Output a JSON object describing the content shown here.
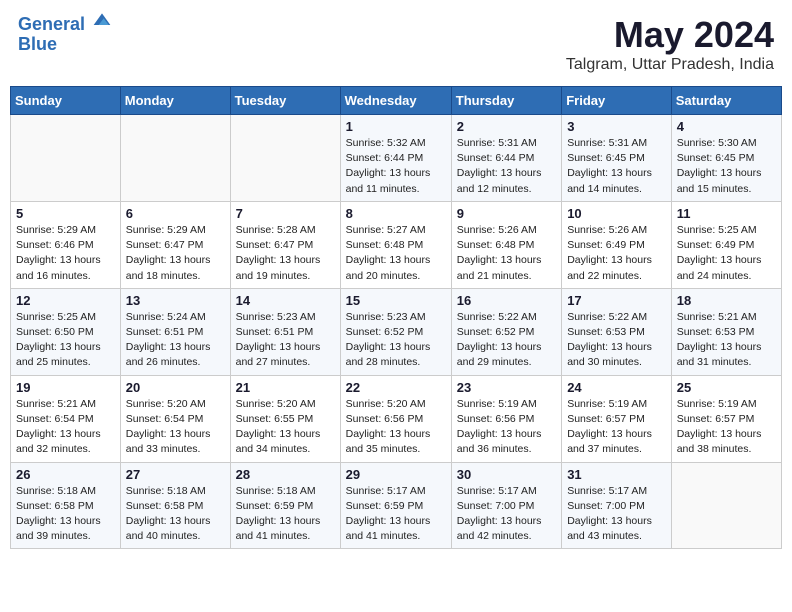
{
  "header": {
    "logo_line1": "General",
    "logo_line2": "Blue",
    "month_year": "May 2024",
    "location": "Talgram, Uttar Pradesh, India"
  },
  "calendar": {
    "days_of_week": [
      "Sunday",
      "Monday",
      "Tuesday",
      "Wednesday",
      "Thursday",
      "Friday",
      "Saturday"
    ],
    "weeks": [
      [
        {
          "day": "",
          "info": ""
        },
        {
          "day": "",
          "info": ""
        },
        {
          "day": "",
          "info": ""
        },
        {
          "day": "1",
          "info": "Sunrise: 5:32 AM\nSunset: 6:44 PM\nDaylight: 13 hours\nand 11 minutes."
        },
        {
          "day": "2",
          "info": "Sunrise: 5:31 AM\nSunset: 6:44 PM\nDaylight: 13 hours\nand 12 minutes."
        },
        {
          "day": "3",
          "info": "Sunrise: 5:31 AM\nSunset: 6:45 PM\nDaylight: 13 hours\nand 14 minutes."
        },
        {
          "day": "4",
          "info": "Sunrise: 5:30 AM\nSunset: 6:45 PM\nDaylight: 13 hours\nand 15 minutes."
        }
      ],
      [
        {
          "day": "5",
          "info": "Sunrise: 5:29 AM\nSunset: 6:46 PM\nDaylight: 13 hours\nand 16 minutes."
        },
        {
          "day": "6",
          "info": "Sunrise: 5:29 AM\nSunset: 6:47 PM\nDaylight: 13 hours\nand 18 minutes."
        },
        {
          "day": "7",
          "info": "Sunrise: 5:28 AM\nSunset: 6:47 PM\nDaylight: 13 hours\nand 19 minutes."
        },
        {
          "day": "8",
          "info": "Sunrise: 5:27 AM\nSunset: 6:48 PM\nDaylight: 13 hours\nand 20 minutes."
        },
        {
          "day": "9",
          "info": "Sunrise: 5:26 AM\nSunset: 6:48 PM\nDaylight: 13 hours\nand 21 minutes."
        },
        {
          "day": "10",
          "info": "Sunrise: 5:26 AM\nSunset: 6:49 PM\nDaylight: 13 hours\nand 22 minutes."
        },
        {
          "day": "11",
          "info": "Sunrise: 5:25 AM\nSunset: 6:49 PM\nDaylight: 13 hours\nand 24 minutes."
        }
      ],
      [
        {
          "day": "12",
          "info": "Sunrise: 5:25 AM\nSunset: 6:50 PM\nDaylight: 13 hours\nand 25 minutes."
        },
        {
          "day": "13",
          "info": "Sunrise: 5:24 AM\nSunset: 6:51 PM\nDaylight: 13 hours\nand 26 minutes."
        },
        {
          "day": "14",
          "info": "Sunrise: 5:23 AM\nSunset: 6:51 PM\nDaylight: 13 hours\nand 27 minutes."
        },
        {
          "day": "15",
          "info": "Sunrise: 5:23 AM\nSunset: 6:52 PM\nDaylight: 13 hours\nand 28 minutes."
        },
        {
          "day": "16",
          "info": "Sunrise: 5:22 AM\nSunset: 6:52 PM\nDaylight: 13 hours\nand 29 minutes."
        },
        {
          "day": "17",
          "info": "Sunrise: 5:22 AM\nSunset: 6:53 PM\nDaylight: 13 hours\nand 30 minutes."
        },
        {
          "day": "18",
          "info": "Sunrise: 5:21 AM\nSunset: 6:53 PM\nDaylight: 13 hours\nand 31 minutes."
        }
      ],
      [
        {
          "day": "19",
          "info": "Sunrise: 5:21 AM\nSunset: 6:54 PM\nDaylight: 13 hours\nand 32 minutes."
        },
        {
          "day": "20",
          "info": "Sunrise: 5:20 AM\nSunset: 6:54 PM\nDaylight: 13 hours\nand 33 minutes."
        },
        {
          "day": "21",
          "info": "Sunrise: 5:20 AM\nSunset: 6:55 PM\nDaylight: 13 hours\nand 34 minutes."
        },
        {
          "day": "22",
          "info": "Sunrise: 5:20 AM\nSunset: 6:56 PM\nDaylight: 13 hours\nand 35 minutes."
        },
        {
          "day": "23",
          "info": "Sunrise: 5:19 AM\nSunset: 6:56 PM\nDaylight: 13 hours\nand 36 minutes."
        },
        {
          "day": "24",
          "info": "Sunrise: 5:19 AM\nSunset: 6:57 PM\nDaylight: 13 hours\nand 37 minutes."
        },
        {
          "day": "25",
          "info": "Sunrise: 5:19 AM\nSunset: 6:57 PM\nDaylight: 13 hours\nand 38 minutes."
        }
      ],
      [
        {
          "day": "26",
          "info": "Sunrise: 5:18 AM\nSunset: 6:58 PM\nDaylight: 13 hours\nand 39 minutes."
        },
        {
          "day": "27",
          "info": "Sunrise: 5:18 AM\nSunset: 6:58 PM\nDaylight: 13 hours\nand 40 minutes."
        },
        {
          "day": "28",
          "info": "Sunrise: 5:18 AM\nSunset: 6:59 PM\nDaylight: 13 hours\nand 41 minutes."
        },
        {
          "day": "29",
          "info": "Sunrise: 5:17 AM\nSunset: 6:59 PM\nDaylight: 13 hours\nand 41 minutes."
        },
        {
          "day": "30",
          "info": "Sunrise: 5:17 AM\nSunset: 7:00 PM\nDaylight: 13 hours\nand 42 minutes."
        },
        {
          "day": "31",
          "info": "Sunrise: 5:17 AM\nSunset: 7:00 PM\nDaylight: 13 hours\nand 43 minutes."
        },
        {
          "day": "",
          "info": ""
        }
      ]
    ]
  }
}
